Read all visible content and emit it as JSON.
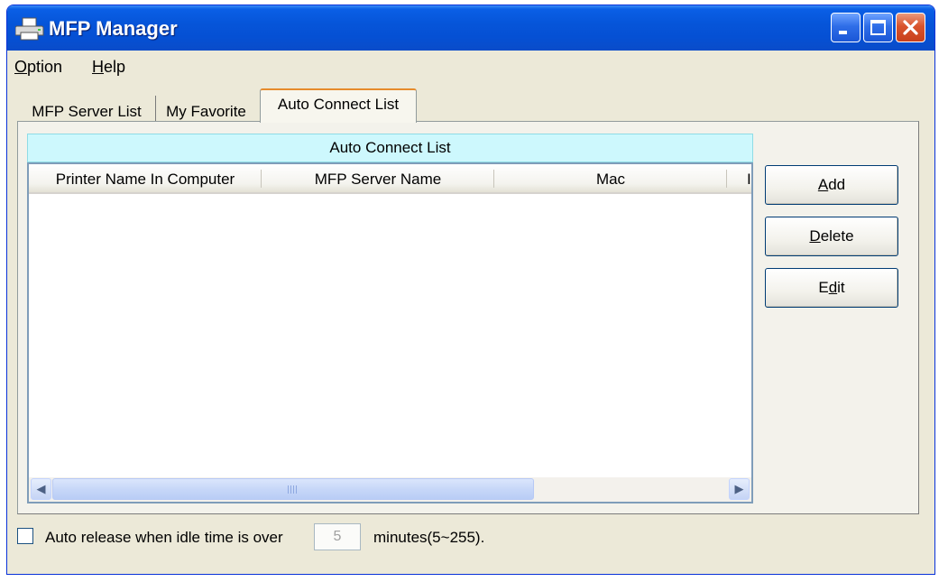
{
  "window": {
    "title": "MFP Manager",
    "title_icon": "printer-icon",
    "controls": [
      "minimize-icon",
      "maximize-icon",
      "close-icon"
    ],
    "colors": {
      "titlebar": "#0655d9",
      "close_button": "#d9542d",
      "face": "#ece9d8"
    }
  },
  "menu": {
    "option": {
      "hotkey": "O",
      "rest": "ption"
    },
    "help": {
      "hotkey": "H",
      "rest": "elp"
    }
  },
  "tabs": [
    {
      "label": "MFP Server List",
      "selected": false
    },
    {
      "label": "My Favorite",
      "selected": false
    },
    {
      "label": "Auto Connect List",
      "selected": true
    }
  ],
  "list": {
    "caption": "Auto Connect List",
    "caption_color": "#cdf8fd",
    "columns": [
      "Printer Name In Computer",
      "MFP Server Name",
      "Mac",
      "I"
    ],
    "rows": [],
    "scroll_arrows": [
      "scroll-left-icon",
      "scroll-right-icon"
    ]
  },
  "buttons": {
    "add": {
      "hotkey": "A",
      "rest": "dd"
    },
    "delete": {
      "hotkey": "D",
      "rest": "elete"
    },
    "edit": {
      "pre": "E",
      "hotkey": "d",
      "rest": "it"
    }
  },
  "footer": {
    "auto_release_checked": false,
    "auto_release_label": "Auto release when idle time is over",
    "idle_minutes": "5",
    "minutes_label": "minutes(5~255)."
  }
}
